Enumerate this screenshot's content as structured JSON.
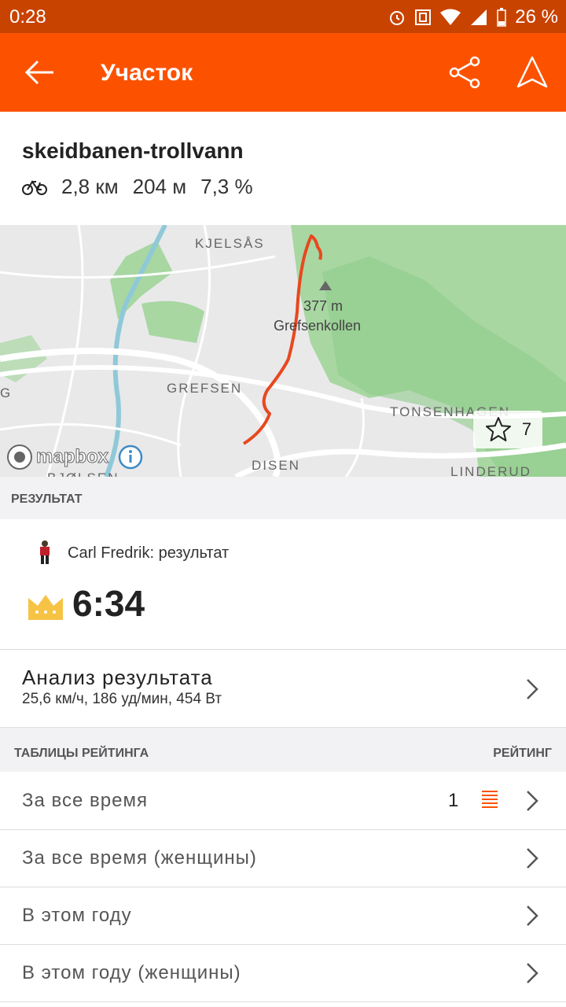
{
  "status": {
    "time": "0:28",
    "battery": "26 %"
  },
  "appbar": {
    "title": "Участок"
  },
  "segment": {
    "name": "skeidbanen-trollvann",
    "distance": "2,8 км",
    "elevation": "204 м",
    "grade": "7,3 %"
  },
  "map": {
    "labels": {
      "kjelsas": "KJELSÅS",
      "grefsen": "GREFSEN",
      "tonsenhagen": "TONSENHAGEN",
      "disen": "DISEN",
      "linderud": "LINDERUD",
      "g": "G",
      "bjolsen": "BJØLSEN"
    },
    "peak_height": "377 m",
    "peak_name": "Grefsenkollen",
    "attribution": "mapbox",
    "star_count": "7"
  },
  "result_section": {
    "header": "РЕЗУЛЬТАТ",
    "athlete_line": "Carl Fredrik: результат",
    "time": "6:34"
  },
  "analysis": {
    "title": "Анализ результата",
    "subtitle": "25,6 км/ч, 186 уд/мин, 454 Вт"
  },
  "leaderboards": {
    "header": "ТАБЛИЦЫ РЕЙТИНГА",
    "rank_header": "РЕЙТИНГ",
    "rows": [
      {
        "label": "За все время",
        "rank": "1"
      },
      {
        "label": "За все время (женщины)",
        "rank": ""
      },
      {
        "label": "В этом году",
        "rank": ""
      },
      {
        "label": "В этом году (женщины)",
        "rank": ""
      }
    ]
  },
  "colors": {
    "brand": "#fc5200",
    "statusbar": "#c84300",
    "route": "#e8481e",
    "crown": "#f6c344"
  }
}
